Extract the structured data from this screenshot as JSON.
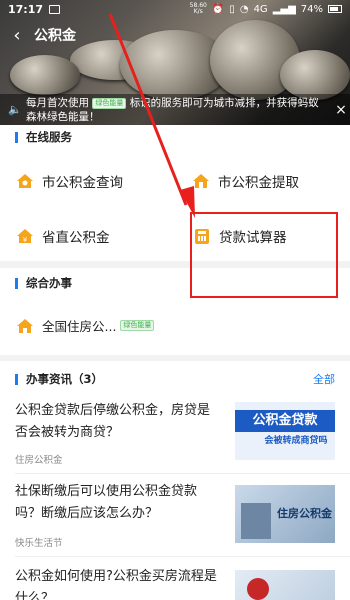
{
  "status_bar": {
    "time": "17:17",
    "speed_top": "58.60",
    "speed_bottom": "K/s",
    "network": "4G",
    "battery": "74%"
  },
  "nav": {
    "back_icon": "chevron-left-icon",
    "title": "公积金"
  },
  "notice": {
    "text_before": "每月首次使用",
    "badge": "绿色能量",
    "text_after": "标识的服务即可为城市减排，并获得蚂蚁森林绿色能量！",
    "close": "×"
  },
  "online_services": {
    "title": "在线服务",
    "items": [
      {
        "label": "市公积金查询",
        "icon": "house-coin-icon"
      },
      {
        "label": "市公积金提取",
        "icon": "house-withdraw-icon"
      },
      {
        "label": "省直公积金",
        "icon": "house-yen-icon"
      },
      {
        "label": "贷款试算器",
        "icon": "calculator-icon"
      }
    ]
  },
  "integrated": {
    "title": "综合办事",
    "items": [
      {
        "label": "全国住房公...",
        "badge": "绿色能量",
        "icon": "house-icon"
      }
    ]
  },
  "news": {
    "title": "办事资讯（3）",
    "all_label": "全部",
    "items": [
      {
        "title": "公积金贷款后停缴公积金，房贷是否会被转为商贷？",
        "source": "住房公积金",
        "thumb_line1": "公积金贷款",
        "thumb_line2": "会被转成商贷吗"
      },
      {
        "title": "社保断缴后可以使用公积金贷款吗？断缴后应该怎么办？",
        "source": "快乐生活节",
        "thumb_line1": "住房公积金"
      },
      {
        "title": "公积金如何使用?公积金买房流程是什么？",
        "source": ""
      }
    ]
  },
  "colors": {
    "accent": "#1a7cf0",
    "icon_orange": "#f4a51c",
    "annotation_red": "#e8201d",
    "green_badge": "#3cb24a"
  }
}
